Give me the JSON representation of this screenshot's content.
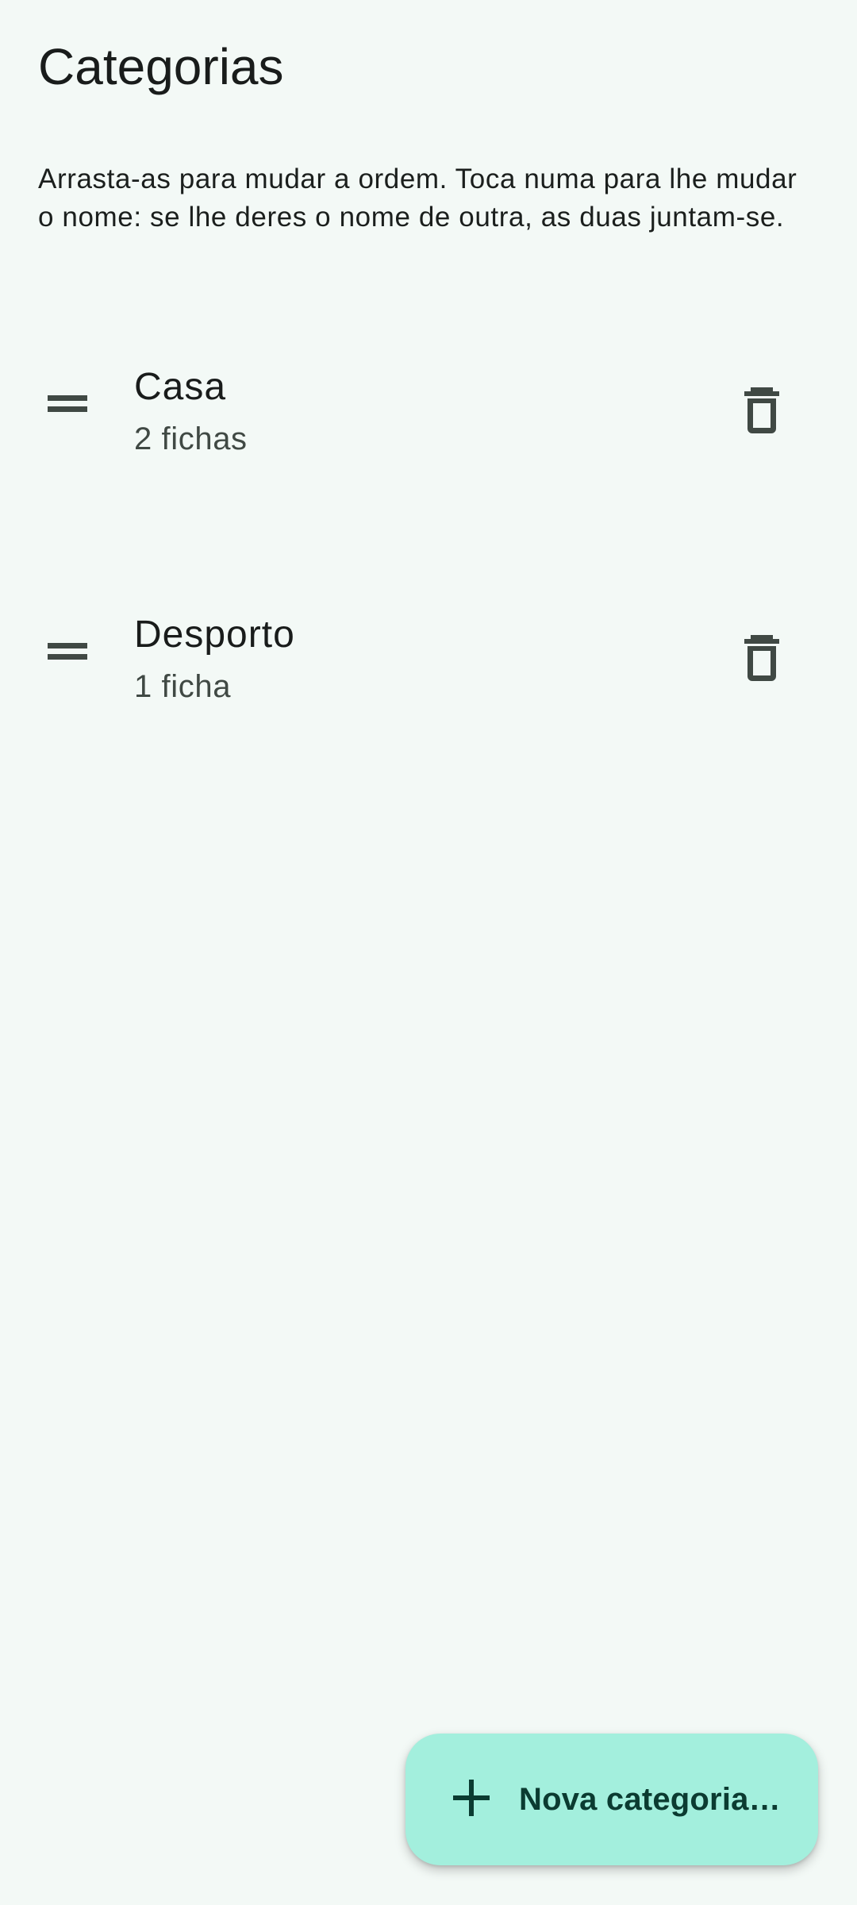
{
  "header": {
    "title": "Categorias"
  },
  "instructions": "Arrasta-as para mudar a ordem. Toca numa para lhe mudar o nome: se lhe deres o nome de outra, as duas juntam-se.",
  "categories": [
    {
      "name": "Casa",
      "count_label": "2 fichas",
      "drag_icon": "drag-handle-icon",
      "delete_icon": "trash-icon"
    },
    {
      "name": "Desporto",
      "count_label": "1 ficha",
      "drag_icon": "drag-handle-icon",
      "delete_icon": "trash-icon"
    }
  ],
  "fab": {
    "icon": "plus-icon",
    "label": "Nova categoria…"
  },
  "colors": {
    "background": "#f3f9f6",
    "fab_background": "#a3efdd",
    "fab_foreground": "#0b3b31",
    "icon": "#404944",
    "text_primary": "#191c1b",
    "text_secondary": "#404944"
  }
}
